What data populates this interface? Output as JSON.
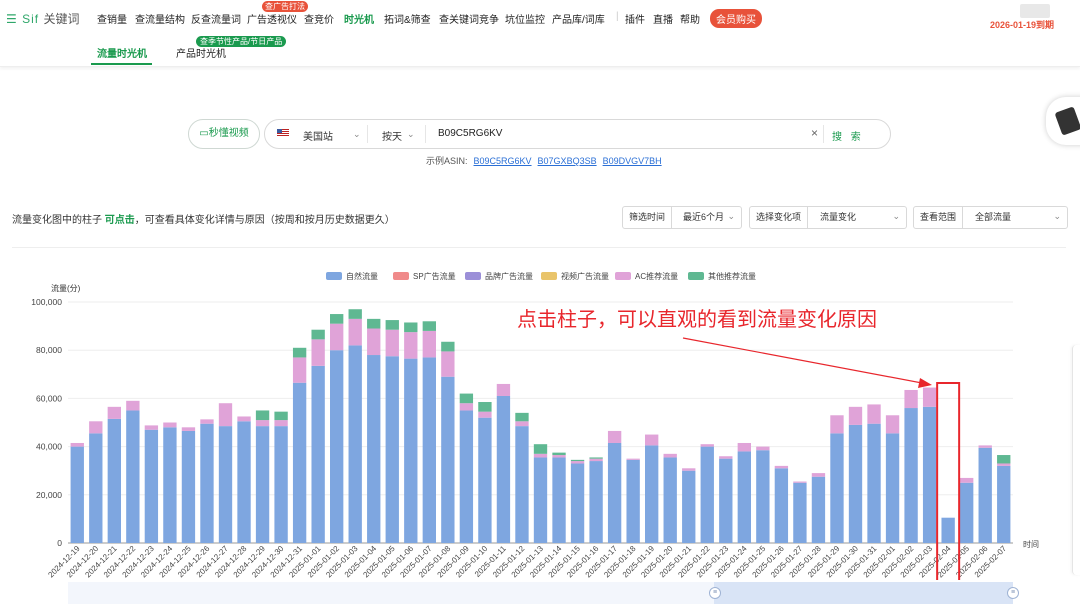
{
  "app": {
    "logo_text": "Sif",
    "logo_sub": "关键词"
  },
  "nav": {
    "items": [
      "查销量",
      "查流量结构",
      "反查流量词",
      "广告透视仪",
      "查竞价",
      "时光机",
      "拓词&筛查",
      "查关键词竞争",
      "坑位监控",
      "产品库/词库",
      "插件",
      "直播",
      "帮助"
    ],
    "active_index": 5,
    "ad_tag": "查广告打法",
    "vip_button": "会员购买",
    "expire": "2026-01-19到期"
  },
  "subtabs": {
    "items": [
      "流量时光机",
      "产品时光机"
    ],
    "active_index": 0,
    "badge": "查季节性产品/节日产品"
  },
  "search": {
    "video_button": "秒懂视频",
    "site": "美国站",
    "granularity": "按天",
    "asin_value": "B09C5RG6KV",
    "clear_icon": "close-icon",
    "search_button": "搜 索",
    "examples_label": "示例ASIN:",
    "examples": [
      "B09C5RG6KV",
      "B07GXBQ3SB",
      "B09DVGV7BH"
    ]
  },
  "description": {
    "prefix": "流量变化图中的柱子 ",
    "highlight": "可点击",
    "suffix": "，可查看具体变化详情与原因（按周和按月历史数据更久）"
  },
  "filters": {
    "time": {
      "label": "筛选时间",
      "value": "最近6个月"
    },
    "change": {
      "label": "选择变化项",
      "value": "流量变化"
    },
    "range": {
      "label": "查看范围",
      "value": "全部流量"
    }
  },
  "annotation": "点击柱子，可以直观的看到流量变化原因",
  "colors": {
    "brand": "#1a9a4e",
    "alert": "#e8262c",
    "natural": "#7ea6e0",
    "sp": "#f08a8a",
    "brand_ad": "#9b8fd8",
    "video_ad": "#e9c46a",
    "ac": "#e0a3d8",
    "other": "#5fb892"
  },
  "chart_data": {
    "type": "bar",
    "stacked": true,
    "ylabel": "流量(分)",
    "xlabel": "时间",
    "ylim": [
      0,
      100000
    ],
    "yticks": [
      "0",
      "20,000",
      "40,000",
      "60,000",
      "80,000",
      "100,000"
    ],
    "legend_position": "top-center",
    "categories": [
      "2024-12-19",
      "2024-12-20",
      "2024-12-21",
      "2024-12-22",
      "2024-12-23",
      "2024-12-24",
      "2024-12-25",
      "2024-12-26",
      "2024-12-27",
      "2024-12-28",
      "2024-12-29",
      "2024-12-30",
      "2024-12-31",
      "2025-01-01",
      "2025-01-02",
      "2025-01-03",
      "2025-01-04",
      "2025-01-05",
      "2025-01-06",
      "2025-01-07",
      "2025-01-08",
      "2025-01-09",
      "2025-01-10",
      "2025-01-11",
      "2025-01-12",
      "2025-01-13",
      "2025-01-14",
      "2025-01-15",
      "2025-01-16",
      "2025-01-17",
      "2025-01-18",
      "2025-01-19",
      "2025-01-20",
      "2025-01-21",
      "2025-01-22",
      "2025-01-23",
      "2025-01-24",
      "2025-01-25",
      "2025-01-26",
      "2025-01-27",
      "2025-01-28",
      "2025-01-29",
      "2025-01-30",
      "2025-01-31",
      "2025-02-01",
      "2025-02-02",
      "2025-02-03",
      "2025-02-04",
      "2025-02-05",
      "2025-02-06",
      "2025-02-07"
    ],
    "series": [
      {
        "name": "自然流量",
        "color": "#7ea6e0",
        "values": [
          40000,
          45500,
          51500,
          55000,
          47000,
          48000,
          46500,
          49500,
          48500,
          50500,
          48500,
          48500,
          66500,
          73500,
          80000,
          82000,
          78000,
          77500,
          76500,
          77000,
          69000,
          55000,
          52000,
          61000,
          48500,
          35500,
          35500,
          33000,
          34000,
          41500,
          34500,
          40500,
          35500,
          30000,
          40000,
          35000,
          38000,
          38500,
          31000,
          25000,
          27500,
          45500,
          49000,
          49500,
          45500,
          56000,
          56500,
          10500,
          25000,
          39500,
          32000
        ]
      },
      {
        "name": "SP广告流量",
        "color": "#f08a8a",
        "values": [
          0,
          0,
          0,
          0,
          0,
          0,
          0,
          0,
          0,
          0,
          0,
          0,
          0,
          0,
          0,
          0,
          0,
          0,
          0,
          0,
          0,
          0,
          0,
          0,
          0,
          0,
          0,
          0,
          0,
          0,
          0,
          0,
          0,
          0,
          0,
          0,
          0,
          0,
          0,
          0,
          0,
          0,
          0,
          0,
          0,
          0,
          0,
          0,
          0,
          0,
          0
        ]
      },
      {
        "name": "品牌广告流量",
        "color": "#9b8fd8",
        "values": [
          0,
          0,
          0,
          0,
          0,
          0,
          0,
          0,
          0,
          0,
          0,
          0,
          0,
          0,
          0,
          0,
          0,
          0,
          0,
          0,
          0,
          0,
          0,
          0,
          0,
          0,
          0,
          0,
          0,
          0,
          0,
          0,
          0,
          0,
          0,
          0,
          0,
          0,
          0,
          0,
          0,
          0,
          0,
          0,
          0,
          0,
          0,
          0,
          0,
          0,
          0
        ]
      },
      {
        "name": "视频广告流量",
        "color": "#e9c46a",
        "values": [
          0,
          0,
          0,
          0,
          0,
          0,
          0,
          0,
          0,
          0,
          0,
          0,
          0,
          0,
          0,
          0,
          0,
          0,
          0,
          0,
          0,
          0,
          0,
          0,
          0,
          0,
          0,
          0,
          0,
          0,
          0,
          0,
          0,
          0,
          0,
          0,
          0,
          0,
          0,
          0,
          0,
          0,
          0,
          0,
          0,
          0,
          0,
          0,
          0,
          0,
          0
        ]
      },
      {
        "name": "AC推荐流量",
        "color": "#e0a3d8",
        "values": [
          1500,
          5000,
          5000,
          4000,
          1800,
          2000,
          1500,
          1800,
          9500,
          2000,
          2500,
          2500,
          10500,
          11000,
          11000,
          11000,
          11000,
          11000,
          11000,
          11000,
          10500,
          3000,
          2500,
          5000,
          2000,
          1500,
          1000,
          1000,
          1000,
          5000,
          500,
          4500,
          1500,
          1000,
          1000,
          1000,
          3500,
          1500,
          1000,
          500,
          1500,
          7500,
          7500,
          8000,
          7500,
          7500,
          8000,
          0,
          2000,
          1000,
          1000
        ]
      },
      {
        "name": "其他推荐流量",
        "color": "#5fb892",
        "values": [
          0,
          0,
          0,
          0,
          0,
          0,
          0,
          0,
          0,
          0,
          4000,
          3500,
          4000,
          4000,
          4000,
          4000,
          4000,
          4000,
          4000,
          4000,
          4000,
          4000,
          4000,
          0,
          3500,
          4000,
          1000,
          500,
          500,
          0,
          0,
          0,
          0,
          0,
          0,
          0,
          0,
          0,
          0,
          0,
          0,
          0,
          0,
          0,
          0,
          0,
          0,
          0,
          0,
          0,
          3500
        ]
      }
    ]
  }
}
